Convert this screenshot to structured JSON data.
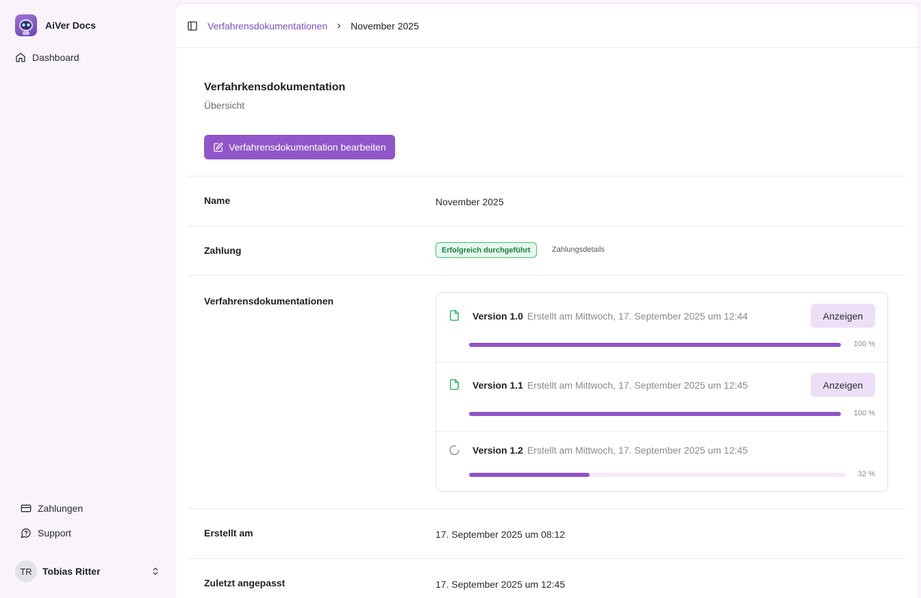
{
  "app": {
    "name": "AiVer Docs"
  },
  "sidebar": {
    "dashboard_label": "Dashboard",
    "payments_label": "Zahlungen",
    "support_label": "Support",
    "user": {
      "initials": "TR",
      "name": "Tobias Ritter"
    }
  },
  "breadcrumb": {
    "parent": "Verfahrensdokumentationen",
    "current": "November 2025"
  },
  "page": {
    "title": "Verfahrkensdokumentation",
    "subtitle": "Übersicht",
    "edit_button": "Verfahrensdokumentation bearbeiten"
  },
  "details": {
    "name": {
      "label": "Name",
      "value": "November 2025"
    },
    "payment": {
      "label": "Zahlung",
      "status": "Erfolgreich durchgeführt",
      "details_link": "Zahlungsdetails"
    },
    "docs_label": "Verfahrensdokumentationen",
    "created": {
      "label": "Erstellt am",
      "value": "17. September 2025 um 08:12"
    },
    "modified": {
      "label": "Zuletzt angepasst",
      "value": "17. September 2025 um 12:45"
    }
  },
  "versions": [
    {
      "name": "Version 1.0",
      "date": "Erstellt am Mittwoch, 17. September 2025 um 12:44",
      "progress": 100,
      "progress_label": "100 %",
      "button": "Anzeigen",
      "icon": "document-icon"
    },
    {
      "name": "Version 1.1",
      "date": "Erstellt am Mittwoch, 17. September 2025 um 12:45",
      "progress": 100,
      "progress_label": "100 %",
      "button": "Anzeigen",
      "icon": "document-icon"
    },
    {
      "name": "Version 1.2",
      "date": "Erstellt am Mittwoch, 17. September 2025 um 12:45",
      "progress": 32,
      "progress_label": "32 %",
      "icon": "spinner-icon"
    }
  ],
  "colors": {
    "accent": "#9156c9",
    "success": "#3cc06f",
    "success_bg": "#e7f8ee"
  }
}
